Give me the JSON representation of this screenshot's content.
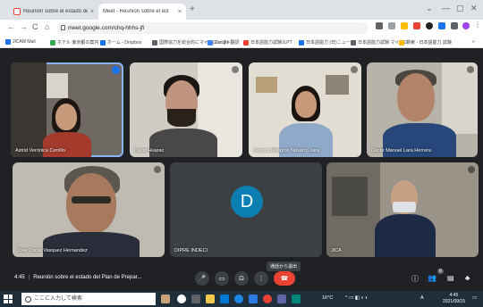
{
  "browser": {
    "tabs": [
      {
        "label": "Reunión sobre el estado del Plan",
        "close": "×"
      },
      {
        "label": "Meet - Reunión sobre el est",
        "close": "×"
      }
    ],
    "new_tab": "+",
    "window_controls": [
      "⌄",
      "—",
      "▢",
      "✕"
    ],
    "nav": {
      "back": "←",
      "forward": "→",
      "reload": "C",
      "home": "⌂"
    },
    "url": "meet.google.com/chq-hhhs-jfi",
    "bookmarks": [
      "JICAM Mail",
      "ホテル 東京都の案内",
      "ホーム - Dropbox",
      "国際協力を総合的にマイクロソフト",
      "Google 翻訳",
      "日本語能力試験JLPT",
      "日本語能力 (日)ニュース",
      "日本語能力試験 マイクロ",
      "検索 - 日本語能力 試験",
      "»"
    ]
  },
  "meet": {
    "participants": [
      {
        "name": "Astrid Verónica Cerrillo",
        "speaking": true
      },
      {
        "name": "David Huarac"
      },
      {
        "name": "Jessica Milagros Navarro Jara"
      },
      {
        "name": "Oscar Manuel Lara Herrera"
      },
      {
        "name": "Jose Oscar Vasquez Hernandez"
      },
      {
        "name": "DIPRE INDECI",
        "initial": "D"
      },
      {
        "name": "JICA"
      }
    ],
    "time": "4:45",
    "meeting_title": "Reunión sobre el estado del Plan de Prepar...",
    "tooltip": "通話から退出",
    "controls": {
      "mic": "🎤",
      "camera": "▭",
      "present": "⊡",
      "more": "⋮",
      "hangup": "☎"
    },
    "right_controls": {
      "info": "ⓘ",
      "people": "👥",
      "people_count": "8",
      "chat": "▤",
      "activities": "♣"
    }
  },
  "taskbar": {
    "search_placeholder": "ここに入力して検索",
    "weather": "16°C",
    "ime": "A",
    "time": "4:45",
    "date": "2021/09/15"
  },
  "colors": {
    "meet_bg": "#202124",
    "tile_bg": "#3c4043",
    "active_outline": "#8ab4f8",
    "hangup": "#ea4335",
    "avatar": "#0b7fb1",
    "taskbar": "#1f2e3b"
  }
}
